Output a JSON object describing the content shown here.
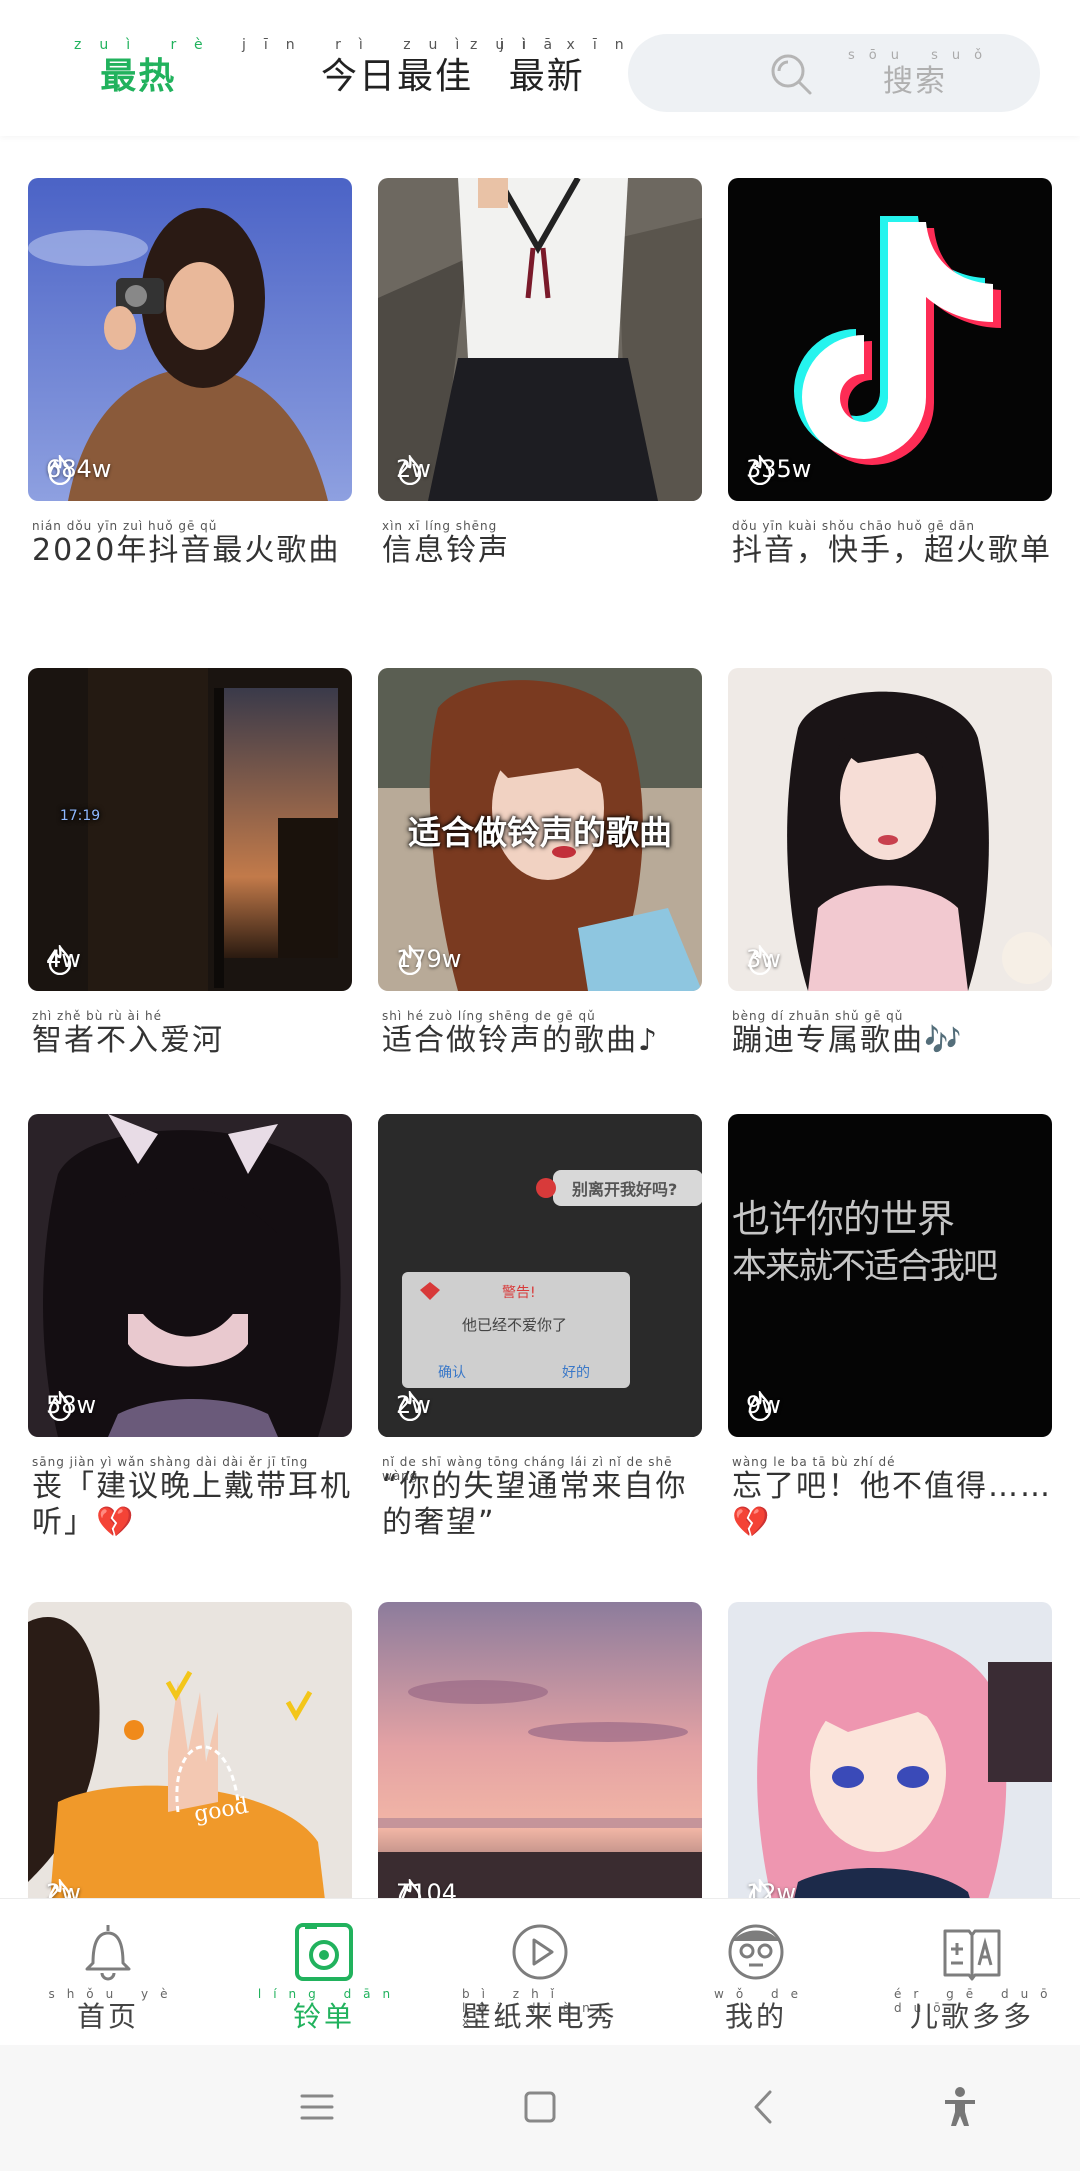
{
  "header": {
    "tabs": [
      {
        "pinyin": "zuì rè",
        "label": "最热",
        "active": true
      },
      {
        "pinyin": "jīn rì zuì jiā",
        "label": "今日最佳",
        "active": false
      },
      {
        "pinyin": "zuì xīn",
        "label": "最新",
        "active": false
      }
    ],
    "search": {
      "pinyin": "sōu suǒ",
      "label": "搜索",
      "icon": "search-icon"
    }
  },
  "cards": [
    {
      "count": "684w",
      "pinyin": "nián dǒu yīn zuì huǒ gē qǔ",
      "title": "2020年抖音最火歌曲"
    },
    {
      "count": "2w",
      "pinyin": "xìn xī líng shēng",
      "title": "信息铃声"
    },
    {
      "count": "335w",
      "pinyin": "dǒu yīn kuài shǒu chāo huǒ gē dān",
      "title": "抖音，快手，超火歌单"
    },
    {
      "count": "4w",
      "pinyin": "zhì zhě bù rù ài hé",
      "title": "智者不入爱河",
      "thumb_text": "17:19"
    },
    {
      "count": "179w",
      "pinyin": "shì hé zuò líng shēng de gē qǔ",
      "title": "适合做铃声的歌曲♪",
      "thumb_text": "适合做铃声的歌曲"
    },
    {
      "count": "3w",
      "pinyin": "bèng dí zhuān shǔ gē qǔ",
      "title": "蹦迪专属歌曲🎶"
    },
    {
      "count": "58w",
      "pinyin": "sāng jiàn yì wǎn shàng dài dài ěr jī tīng",
      "title": "丧「建议晚上戴带耳机听」💔"
    },
    {
      "count": "2w",
      "pinyin": "nǐ de shī wàng tōng cháng lái zì nǐ de shē wàng",
      "title": "“你的失望通常来自你的奢望”",
      "thumb_texts": [
        "别离开我好吗?",
        "警告!",
        "他已经不爱你了",
        "确认",
        "好的"
      ]
    },
    {
      "count": "9w",
      "pinyin": "wàng le ba tā bù zhí dé",
      "title": "忘了吧！他不值得……💔",
      "thumb_texts": [
        "也许你的世界",
        "本来就不适合我吧"
      ]
    },
    {
      "count": "2w",
      "title": "",
      "thumb_text": "good"
    },
    {
      "count": "7104",
      "title": ""
    },
    {
      "count": "12w",
      "title": ""
    }
  ],
  "bottom_nav": [
    {
      "pinyin": "shǒu yè",
      "label": "首页",
      "icon": "bell-icon",
      "active": false
    },
    {
      "pinyin": "líng dān",
      "label": "铃单",
      "icon": "ring-list-icon",
      "active": true
    },
    {
      "pinyin": "bì zhǐ lái diàn xiù",
      "label": "壁纸来电秀",
      "icon": "play-icon",
      "active": false
    },
    {
      "pinyin": "wǒ de",
      "label": "我的",
      "icon": "avatar-icon",
      "active": false
    },
    {
      "pinyin": "ér gē duō duō",
      "label": "儿歌多多",
      "icon": "book-icon",
      "active": false
    }
  ],
  "system_bar": [
    "menu-icon",
    "home-icon",
    "back-icon",
    "accessibility-icon"
  ],
  "colors": {
    "accent": "#21b25d",
    "text": "#333333",
    "search_bg": "#eef1f4"
  }
}
